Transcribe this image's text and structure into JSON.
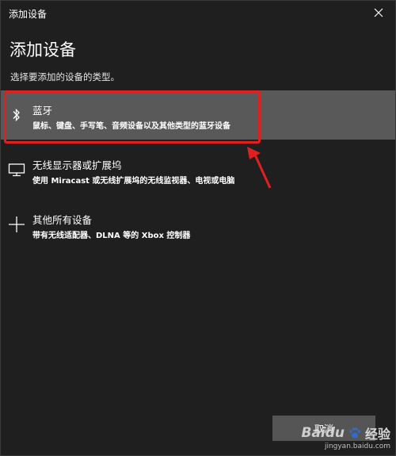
{
  "window": {
    "title": "添加设备",
    "close_label": "✕"
  },
  "main": {
    "heading": "添加设备",
    "subtitle": "选择要添加的设备的类型。"
  },
  "options": [
    {
      "name": "蓝牙",
      "desc": "鼠标、键盘、手写笔、音频设备以及其他类型的蓝牙设备",
      "icon": "bluetooth-icon",
      "selected": true
    },
    {
      "name": "无线显示器或扩展坞",
      "desc": "使用 Miracast 或无线扩展坞的无线监视器、电视或电脑",
      "icon": "monitor-icon",
      "selected": false
    },
    {
      "name": "其他所有设备",
      "desc": "带有无线适配器、DLNA 等的 Xbox 控制器",
      "icon": "plus-icon",
      "selected": false
    }
  ],
  "footer": {
    "cancel_label": "取消"
  },
  "watermark": {
    "logo": "Baidu",
    "cn": "经验",
    "url": "jingyan.baidu.com"
  },
  "colors": {
    "background": "#1f1f1f",
    "selected_row": "#595959",
    "highlight": "#e02020",
    "button": "#555555"
  }
}
